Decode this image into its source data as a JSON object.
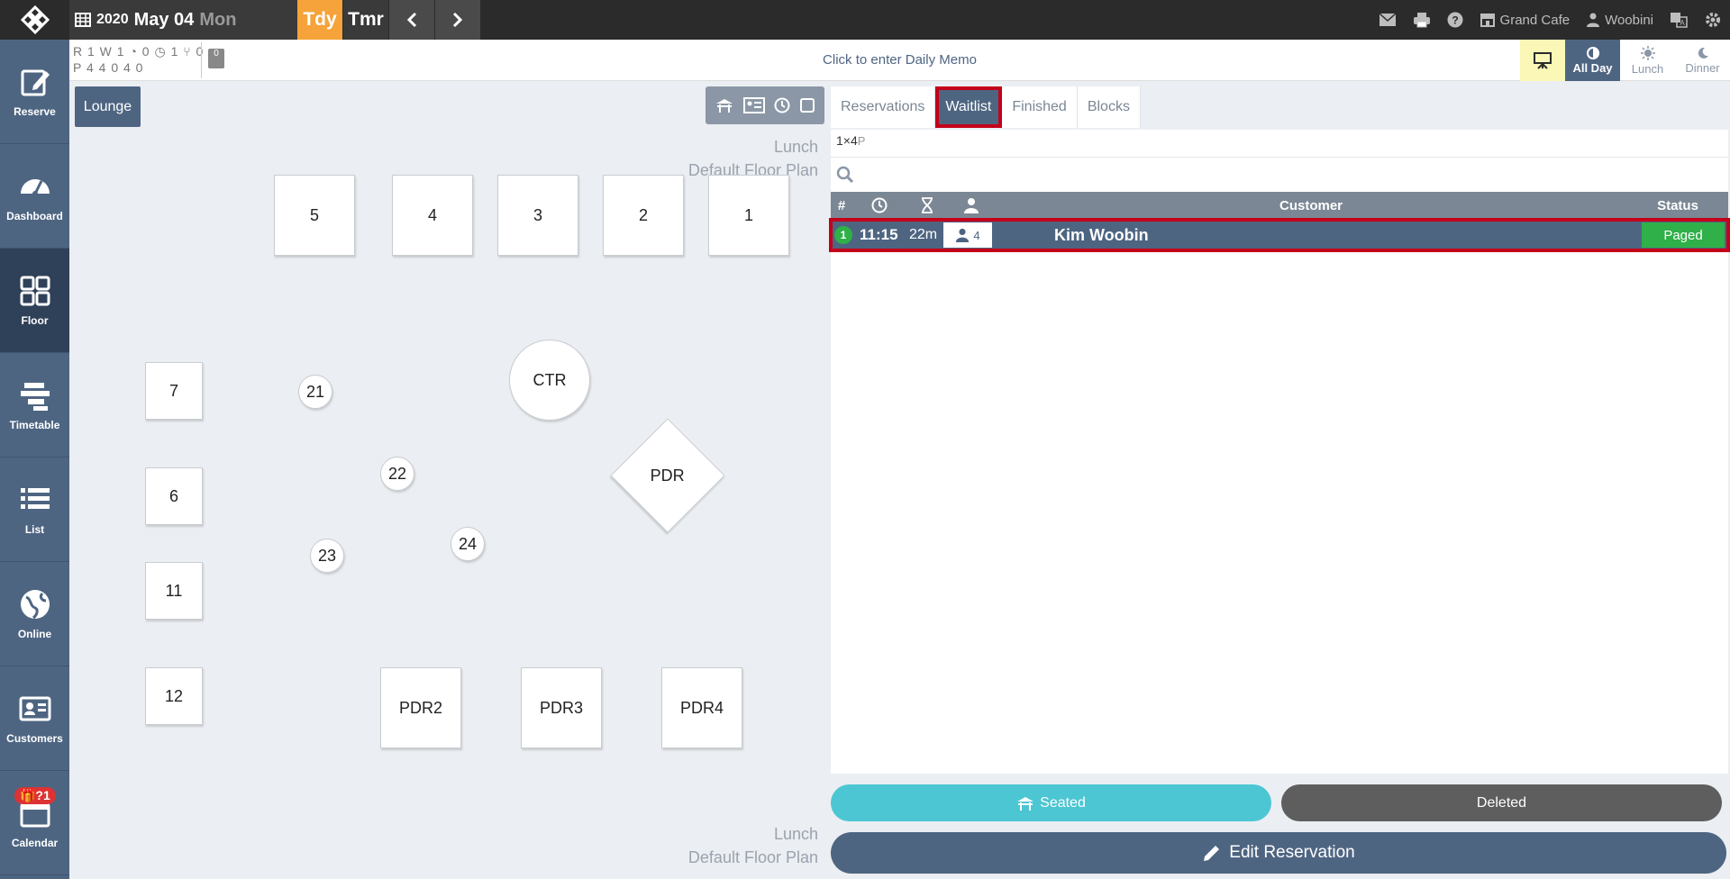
{
  "topbar": {
    "logo_icon": "app-logo-icon",
    "year": "2020",
    "month_day": "May 04",
    "weekday": "Mon",
    "today_label": "Tdy",
    "tomorrow_label": "Tmr",
    "accent_color": "#f5a33a",
    "right": {
      "restaurant": "Grand Cafe",
      "user": "Woobini"
    }
  },
  "sidebar": {
    "items": [
      {
        "label": "Reserve",
        "icon": "edit-icon"
      },
      {
        "label": "Dashboard",
        "icon": "dashboard-icon"
      },
      {
        "label": "Floor",
        "icon": "grid-icon"
      },
      {
        "label": "Timetable",
        "icon": "timetable-icon"
      },
      {
        "label": "List",
        "icon": "list-icon"
      },
      {
        "label": "Online",
        "icon": "globe-icon"
      },
      {
        "label": "Customers",
        "icon": "customer-card-icon"
      },
      {
        "label": "Calendar",
        "icon": "calendar-icon",
        "badge": "🎁?1"
      }
    ],
    "active": "Floor"
  },
  "stats": {
    "row1": "R 1 W 1 ◔ 0 ◷ 1 ⑂ 0",
    "row2": "P 4   4   0   4   0",
    "clipboard_count": "0"
  },
  "memo": "Click to enter Daily Memo",
  "meals": {
    "all_day": "All Day",
    "lunch": "Lunch",
    "dinner": "Dinner"
  },
  "floor": {
    "area_tab": "Lounge",
    "plan_line1": "Lunch",
    "plan_line2": "Default Floor Plan",
    "tables": {
      "t5": "5",
      "t4": "4",
      "t3": "3",
      "t2": "2",
      "t1": "1",
      "t7": "7",
      "t6": "6",
      "t11": "11",
      "t12": "12",
      "t21": "21",
      "t22": "22",
      "t23": "23",
      "t24": "24",
      "ctr": "CTR",
      "pdr": "PDR",
      "pdr2": "PDR2",
      "pdr3": "PDR3",
      "pdr4": "PDR4"
    }
  },
  "panel": {
    "tabs": [
      "Reservations",
      "Waitlist",
      "Finished",
      "Blocks"
    ],
    "active_tab": "Waitlist",
    "count_prefix": "1×4",
    "count_suffix": "P",
    "search_placeholder": "",
    "columns": {
      "num": "#",
      "customer": "Customer",
      "status": "Status"
    },
    "rows": [
      {
        "num": "1",
        "time": "11:15",
        "duration": "22m",
        "party": "4",
        "name": "Kim Woobin",
        "status": "Paged",
        "status_color": "#2fb048"
      }
    ],
    "buttons": {
      "seated": "Seated",
      "deleted": "Deleted",
      "edit": "Edit Reservation"
    }
  }
}
